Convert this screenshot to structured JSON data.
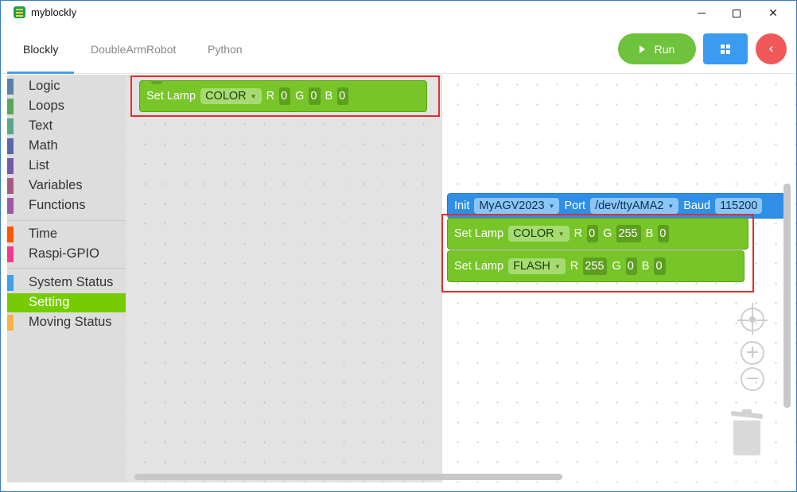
{
  "window": {
    "title": "myblockly"
  },
  "tabs": [
    {
      "label": "Blockly",
      "active": true
    },
    {
      "label": "DoubleArmRobot",
      "active": false
    },
    {
      "label": "Python",
      "active": false
    }
  ],
  "toolbar": {
    "run_label": "Run"
  },
  "categories": [
    {
      "label": "Logic",
      "color": "#5b80a5"
    },
    {
      "label": "Loops",
      "color": "#5ba55b"
    },
    {
      "label": "Text",
      "color": "#5ba58c"
    },
    {
      "label": "Math",
      "color": "#5b67a5"
    },
    {
      "label": "List",
      "color": "#745ba5"
    },
    {
      "label": "Variables",
      "color": "#a55b80"
    },
    {
      "label": "Functions",
      "color": "#995ba5"
    },
    {
      "label": "Time",
      "color": "#ff5500"
    },
    {
      "label": "Raspi-GPIO",
      "color": "#ee3c8c"
    },
    {
      "label": "System Status",
      "color": "#3fa0e6"
    },
    {
      "label": "Setting",
      "color": "#76cc00",
      "selected": true
    },
    {
      "label": "Moving Status",
      "color": "#f7b34a"
    }
  ],
  "flyout_block": {
    "label": "Set Lamp",
    "mode": "COLOR",
    "r_label": "R",
    "r": "0",
    "g_label": "G",
    "g": "0",
    "b_label": "B",
    "b": "0"
  },
  "init_block": {
    "label": "Init",
    "name": "MyAGV2023",
    "port_label": "Port",
    "port": "/dev/ttyAMA2",
    "baud_label": "Baud",
    "baud": "115200"
  },
  "lamp_block_1": {
    "label": "Set Lamp",
    "mode": "COLOR",
    "r_label": "R",
    "r": "0",
    "g_label": "G",
    "g": "255",
    "b_label": "B",
    "b": "0"
  },
  "lamp_block_2": {
    "label": "Set Lamp",
    "mode": "FLASH",
    "r_label": "R",
    "r": "255",
    "g_label": "G",
    "g": "0",
    "b_label": "B",
    "b": "0"
  }
}
